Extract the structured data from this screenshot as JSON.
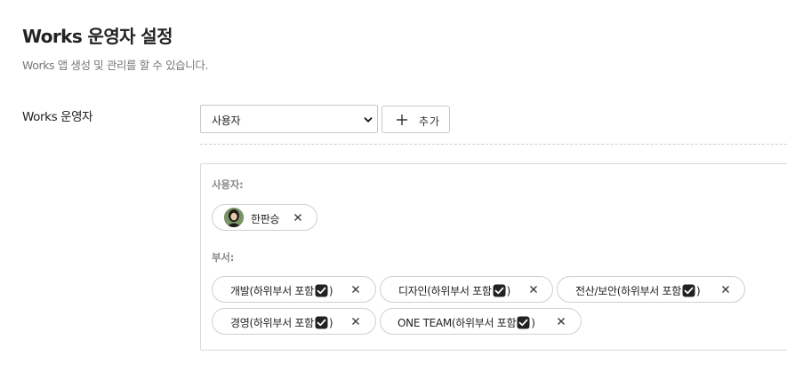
{
  "page": {
    "title": "Works 운영자 설정",
    "description": "Works 앱 생성 및 관리를 할 수 있습니다."
  },
  "field": {
    "label": "Works 운영자"
  },
  "type_select": {
    "value": "사용자"
  },
  "add_button": {
    "label": "추가"
  },
  "selection": {
    "users_title": "사용자:",
    "users": [
      {
        "name": "한판승"
      }
    ],
    "departments_title": "부서:",
    "departments": [
      {
        "name": "개발(하위부서 포함",
        "suffix": ")"
      },
      {
        "name": "디자인(하위부서 포함",
        "suffix": ")"
      },
      {
        "name": "전산/보안(하위부서 포함",
        "suffix": ")"
      },
      {
        "name": "경영(하위부서 포함",
        "suffix": ")"
      },
      {
        "name": "ONE TEAM(하위부서 포함",
        "suffix": ")"
      }
    ]
  },
  "icons": {
    "add": "plus-icon",
    "remove": "close-icon",
    "included": "checkbox-checked-icon",
    "dropdown": "chevron-down-icon"
  },
  "colors": {
    "checkbox": "#222222",
    "chip_border": "#cfcfcf",
    "muted_text": "#888888"
  }
}
